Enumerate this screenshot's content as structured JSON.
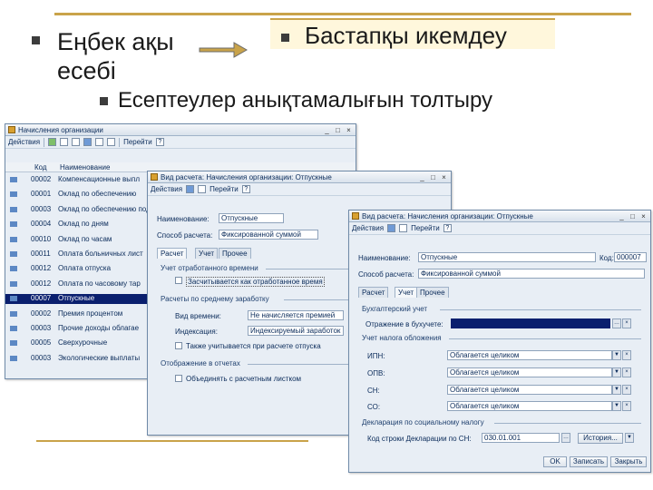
{
  "slide": {
    "title_part1": "Еңбек ақы есебі",
    "title_part2": "Бастапқы икемдеу",
    "subtitle": "Есептеулер анықтамалығын толтыру"
  },
  "window_list": {
    "title": "Начисления организации",
    "menu_actions": "Действия",
    "menu_goto": "Перейти",
    "col_code": "Код",
    "col_name": "Наименование",
    "rows": [
      {
        "code": "00002",
        "name": "Компенсационные выпл"
      },
      {
        "code": "00001",
        "name": "Оклад по обеспечению"
      },
      {
        "code": "00003",
        "name": "Оклад по обеспечению под"
      },
      {
        "code": "00004",
        "name": "Оклад по дням"
      },
      {
        "code": "00010",
        "name": "Оклад по часам"
      },
      {
        "code": "00011",
        "name": "Оплата больничных лист"
      },
      {
        "code": "00012",
        "name": "Оплата отпуска"
      },
      {
        "code": "00012",
        "name": "Оплата по часовому тар"
      },
      {
        "code": "00007",
        "name": "Отпускные"
      },
      {
        "code": "00002",
        "name": "Премия процентом"
      },
      {
        "code": "00003",
        "name": "Прочие доходы облагае"
      },
      {
        "code": "00005",
        "name": "Сверхурочные"
      },
      {
        "code": "00003",
        "name": "Экологические выплаты"
      }
    ]
  },
  "window_mid": {
    "title": "Вид расчета: Начисления организации: Отпускные",
    "menu_actions": "Действия",
    "menu_goto": "Перейти",
    "label_name": "Наименование:",
    "value_name": "Отпускные",
    "label_method": "Способ расчета:",
    "value_method": "Фиксированной суммой",
    "tab1": "Расчет",
    "tab2": "Учет",
    "tab3": "Прочее",
    "section_time": "Учет отработанного времени",
    "check_time": "Засчитывается как отработанное время",
    "section_avg": "Расчеты по среднему заработку",
    "label_type": "Вид времени:",
    "value_type": "Не начисляется премией",
    "label_index": "Индексация:",
    "value_index": "Индексируемый заработок",
    "check_avg": "Также учитывается при расчете отпуска",
    "section_display": "Отображение в отчетах",
    "check_display": "Объединять с расчетным листком"
  },
  "window_front": {
    "title": "Вид расчета: Начисления организации: Отпускные",
    "menu_actions": "Действия",
    "menu_goto": "Перейти",
    "label_name": "Наименование:",
    "value_name": "Отпускные",
    "label_code": "Код:",
    "value_code": "000007",
    "label_method": "Способ расчета:",
    "value_method": "Фиксированной суммой",
    "tab1": "Расчет",
    "tab2": "Учет",
    "tab3": "Прочее",
    "section_acc": "Бухгалтерский учет",
    "label_reflect": "Отражение в бухучете:",
    "section_tax": "Учет налога обложения",
    "label_ipn": "ИПН:",
    "value_ipn": "Облагается целиком",
    "label_opv": "ОПВ:",
    "value_opv": "Облагается целиком",
    "label_sn": "СН:",
    "value_sn": "Облагается целиком",
    "label_so": "СО:",
    "value_so": "Облагается целиком",
    "section_decl": "Декларация по социальному налогу",
    "label_decl": "Код строки Декларации по СН:",
    "value_decl": "030.01.001",
    "btn_history": "История...",
    "btn_ok": "OK",
    "btn_save": "Записать",
    "btn_close": "Закрыть"
  },
  "colors": {
    "accent_gold": "#c9a34a",
    "selection_blue": "#0a1f6e",
    "window_bg": "#e8eef5"
  }
}
